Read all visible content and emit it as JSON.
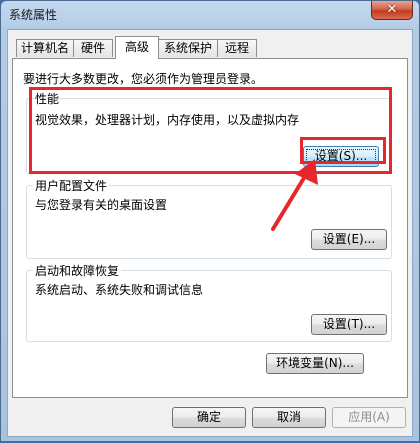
{
  "window": {
    "title": "系统属性",
    "close_glyph": "✕"
  },
  "tabs": [
    {
      "label": "计算机名"
    },
    {
      "label": "硬件"
    },
    {
      "label": "高级"
    },
    {
      "label": "系统保护"
    },
    {
      "label": "远程"
    }
  ],
  "active_tab": "高级",
  "admin_note": "要进行大多数更改，您必须作为管理员登录。",
  "performance": {
    "title": "性能",
    "description": "视觉效果，处理器计划，内存使用，以及虚拟内存",
    "button": "设置(S)..."
  },
  "user_profiles": {
    "title": "用户配置文件",
    "description": "与您登录有关的桌面设置",
    "button": "设置(E)..."
  },
  "startup_recovery": {
    "title": "启动和故障恢复",
    "description": "系统启动、系统失败和调试信息",
    "button": "设置(T)..."
  },
  "env_button": "环境变量(N)...",
  "footer": {
    "ok": "确定",
    "cancel": "取消",
    "apply": "应用(A)"
  },
  "annotation": {
    "highlight_color": "#e8262d",
    "icon": "arrow-icon"
  },
  "colors": {
    "focus_button_border": "#3c7fb1",
    "disabled_text": "#8d8d8d"
  }
}
